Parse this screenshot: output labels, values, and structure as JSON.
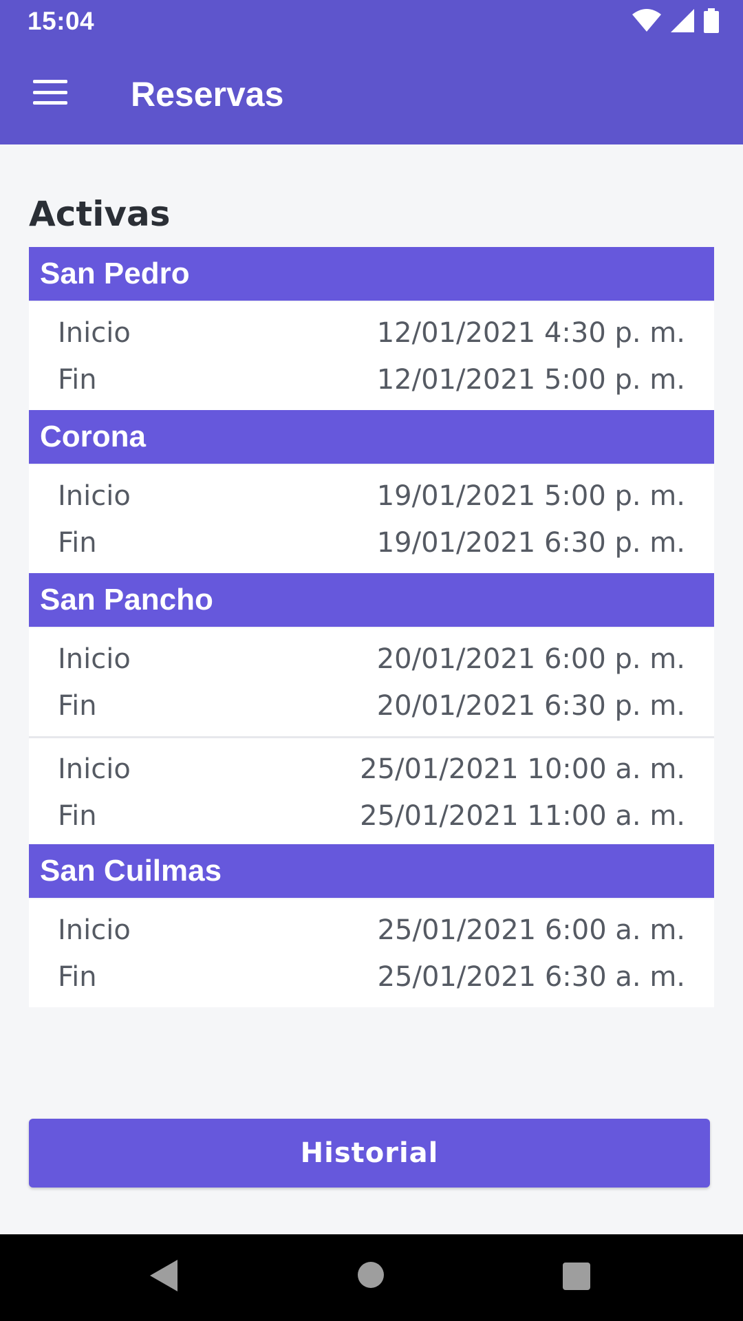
{
  "status_bar": {
    "time": "15:04"
  },
  "app_bar": {
    "title": "Reservas"
  },
  "section": {
    "title": "Activas"
  },
  "groups": [
    {
      "name": "San Pedro",
      "reservations": [
        {
          "start_label": "Inicio",
          "start": "12/01/2021 4:30 p. m.",
          "end_label": "Fin",
          "end": "12/01/2021 5:00 p. m."
        }
      ]
    },
    {
      "name": "Corona",
      "reservations": [
        {
          "start_label": "Inicio",
          "start": "19/01/2021 5:00 p. m.",
          "end_label": "Fin",
          "end": "19/01/2021 6:30 p. m."
        }
      ]
    },
    {
      "name": "San Pancho",
      "reservations": [
        {
          "start_label": "Inicio",
          "start": "20/01/2021 6:00 p. m.",
          "end_label": "Fin",
          "end": "20/01/2021 6:30 p. m."
        },
        {
          "start_label": "Inicio",
          "start": "25/01/2021 10:00 a. m.",
          "end_label": "Fin",
          "end": "25/01/2021 11:00 a. m."
        }
      ]
    },
    {
      "name": "San Cuilmas",
      "reservations": [
        {
          "start_label": "Inicio",
          "start": "25/01/2021 6:00 a. m.",
          "end_label": "Fin",
          "end": "25/01/2021 6:30 a. m."
        }
      ]
    }
  ],
  "button": {
    "label": "Historial"
  },
  "icons": {
    "menu": "hamburger-menu-icon",
    "wifi": "wifi-icon",
    "signal": "signal-icon",
    "battery": "battery-icon",
    "back": "back-icon",
    "home": "home-icon",
    "recents": "recents-icon"
  },
  "colors": {
    "primary": "#5e55cc",
    "accent": "#6658dc",
    "background": "#f5f6f8"
  }
}
